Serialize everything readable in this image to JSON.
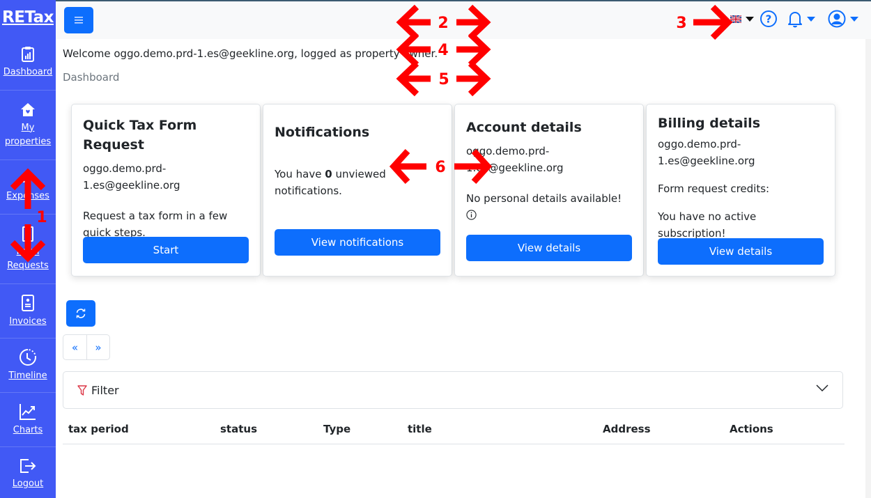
{
  "app": {
    "brand": "RETax"
  },
  "sidebar": {
    "items": [
      {
        "label": "Dashboard",
        "icon": "clipboard-chart-icon"
      },
      {
        "label_line1": "My",
        "label_line2": "properties",
        "icon": "house-heart-icon"
      },
      {
        "label": "Expenses",
        "icon": "coins-icon"
      },
      {
        "label_line1": "Form",
        "label_line2": "Requests",
        "icon": "form-document-icon"
      },
      {
        "label": "Invoices",
        "icon": "invoice-icon"
      },
      {
        "label": "Timeline",
        "icon": "clock-icon"
      },
      {
        "label": "Charts",
        "icon": "line-chart-icon"
      },
      {
        "label": "Logout",
        "icon": "logout-icon"
      }
    ]
  },
  "topbar": {
    "menu_icon": "hamburger-icon",
    "language": "en-GB",
    "language_icon": "uk-flag-icon",
    "help_icon": "question-circle-icon",
    "notifications_icon": "bell-icon",
    "user_icon": "user-circle-icon"
  },
  "main": {
    "welcome": "Welcome oggo.demo.prd-1.es@geekline.org, logged as property owner.",
    "breadcrumb": "Dashboard",
    "cards": [
      {
        "title": "Quick Tax Form Request",
        "email_line1": "oggo.demo.prd-",
        "email_line2": "1.es@geekline.org",
        "text": "Request a tax form in a few quick steps.",
        "button": "Start"
      },
      {
        "title": "Notifications",
        "text_prefix": "You have",
        "count": "0",
        "text_suffix": "unviewed notifications.",
        "button": "View notifications"
      },
      {
        "title": "Account details",
        "email_line1": "oggo.demo.prd-",
        "email_line2": "1.es@geekline.org",
        "text": "No personal details available!",
        "button": "View details"
      },
      {
        "title": "Billing details",
        "email_line1": "oggo.demo.prd-",
        "email_line2": "1.es@geekline.org",
        "credits_label": "Form request credits:",
        "subscription_text": "You have no active subscription!",
        "button": "View details"
      }
    ],
    "pager": {
      "prev": "«",
      "next": "»"
    },
    "filter": {
      "label": "Filter"
    },
    "table": {
      "columns": [
        "tax period",
        "status",
        "Type",
        "title",
        "Address",
        "Actions"
      ],
      "rows": []
    }
  },
  "annotations": {
    "color": "#ff0000",
    "labels": [
      "1",
      "2",
      "3",
      "4",
      "5",
      "6"
    ]
  }
}
